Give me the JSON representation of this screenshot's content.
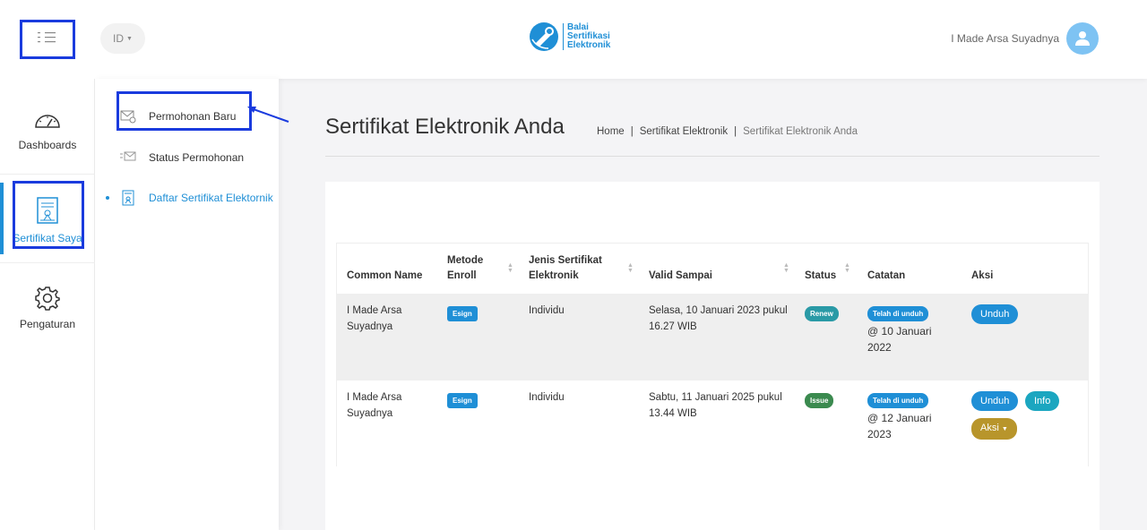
{
  "header": {
    "lang": "ID",
    "logo_lines": [
      "Balai",
      "Sertifikasi",
      "Elektronik"
    ],
    "user_name": "I Made Arsa Suyadnya"
  },
  "leftnav": {
    "items": [
      {
        "label": "Dashboards",
        "icon": "speedometer-icon"
      },
      {
        "label": "Sertifikat Saya",
        "icon": "certificate-icon"
      },
      {
        "label": "Pengaturan",
        "icon": "gear-icon"
      }
    ]
  },
  "subnav": {
    "items": [
      {
        "label": "Permohonan Baru",
        "icon": "envelope-new-icon"
      },
      {
        "label": "Status Permohonan",
        "icon": "envelope-status-icon"
      },
      {
        "label": "Daftar Sertifikat Elektornik",
        "icon": "certificate-list-icon"
      }
    ]
  },
  "page": {
    "title": "Sertifikat Elektronik Anda",
    "breadcrumb": [
      "Home",
      "Sertifikat Elektronik",
      "Sertifikat Elektronik Anda"
    ],
    "breadcrumb_sep": "|"
  },
  "table": {
    "headers": [
      "Common Name",
      "Metode Enroll",
      "Jenis Sertifikat Elektronik",
      "Valid Sampai",
      "Status",
      "Catatan",
      "Aksi"
    ],
    "rows": [
      {
        "common_name": "I Made Arsa Suyadnya",
        "metode": "Esign",
        "jenis": "Individu",
        "valid": "Selasa, 10 Januari 2023 pukul 16.27 WIB",
        "status": "Renew",
        "catatan_badge": "Telah di unduh",
        "catatan_date": "@ 10 Januari 2022",
        "actions": [
          "Unduh"
        ]
      },
      {
        "common_name": "I Made Arsa Suyadnya",
        "metode": "Esign",
        "jenis": "Individu",
        "valid": "Sabtu, 11 Januari 2025 pukul 13.44 WIB",
        "status": "Issue",
        "catatan_badge": "Telah di unduh",
        "catatan_date": "@ 12 Januari 2023",
        "actions": [
          "Unduh",
          "Info",
          "Aksi"
        ]
      }
    ]
  },
  "colors": {
    "primary": "#1f8fd6",
    "highlight": "#1a3bde",
    "renew": "#2a9aa6",
    "issue": "#3b8a4f",
    "info": "#1ba6c0",
    "aksi": "#b8952b"
  }
}
